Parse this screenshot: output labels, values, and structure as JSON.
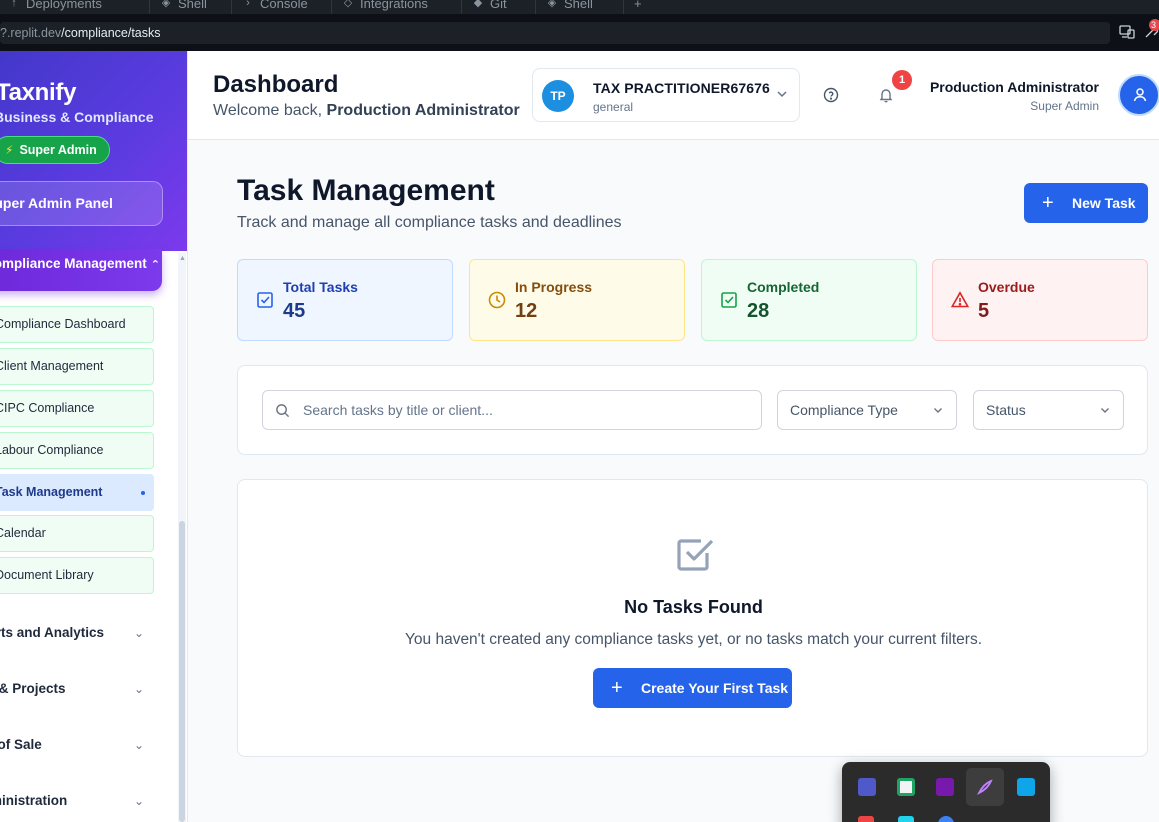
{
  "browser": {
    "tabs": [
      {
        "label": "Deployments",
        "icon": "rocket-icon"
      },
      {
        "label": "Shell",
        "icon": "shell-icon"
      },
      {
        "label": "Console",
        "icon": "terminal-icon"
      },
      {
        "label": "Integrations",
        "icon": "layers-icon"
      },
      {
        "label": "Git",
        "icon": "git-icon"
      },
      {
        "label": "Shell",
        "icon": "shell-icon"
      }
    ],
    "url_prefix": "?.replit.dev",
    "url_path": "/compliance/tasks",
    "extension_badge": "3"
  },
  "sidebar": {
    "brand": "Taxnify",
    "brand_sub": "Business & Compliance",
    "role_pill": "Super Admin",
    "panel_button": "Super Admin Panel",
    "section": "Compliance Management",
    "sub_items": [
      {
        "label": "Compliance Dashboard",
        "active": false
      },
      {
        "label": "Client Management",
        "active": false
      },
      {
        "label": "CIPC Compliance",
        "active": false
      },
      {
        "label": "Labour Compliance",
        "active": false
      },
      {
        "label": "Task Management",
        "active": true
      },
      {
        "label": "Calendar",
        "active": false
      },
      {
        "label": "Document Library",
        "active": false
      }
    ],
    "nav_items": [
      {
        "label": "Reports and Analytics"
      },
      {
        "label": "Bill & Projects"
      },
      {
        "label": "Point of Sale"
      },
      {
        "label": "Administration"
      }
    ]
  },
  "header": {
    "title": "Dashboard",
    "welcome_prefix": "Welcome back, ",
    "welcome_name": "Production Administrator",
    "practitioner": {
      "initials": "TP",
      "name": "TAX PRACTITIONER67676",
      "sub": "general"
    },
    "notifications_count": "1",
    "user_name": "Production Administrator",
    "user_role": "Super Admin"
  },
  "main": {
    "title": "Task Management",
    "subtitle": "Track and manage all compliance tasks and deadlines",
    "new_task_label": "New Task",
    "stats": [
      {
        "label": "Total Tasks",
        "value": "45",
        "icon": "checkbox-icon",
        "color": "#2563eb"
      },
      {
        "label": "In Progress",
        "value": "12",
        "icon": "clock-icon",
        "color": "#ca8a04"
      },
      {
        "label": "Completed",
        "value": "28",
        "icon": "check-square-icon",
        "color": "#16a34a"
      },
      {
        "label": "Overdue",
        "value": "5",
        "icon": "alert-triangle-icon",
        "color": "#dc2626"
      }
    ],
    "search_placeholder": "Search tasks by title or client...",
    "filter_compliance_type": "Compliance Type",
    "filter_status": "Status",
    "empty": {
      "title": "No Tasks Found",
      "description": "You haven't created any compliance tasks yet, or no tasks match your current filters.",
      "button": "Create Your First Task"
    }
  },
  "colors": {
    "primary": "#2563eb",
    "sidebar_gradient_start": "#4338ca",
    "sidebar_gradient_end": "#7c3aed",
    "success": "#16a34a"
  }
}
